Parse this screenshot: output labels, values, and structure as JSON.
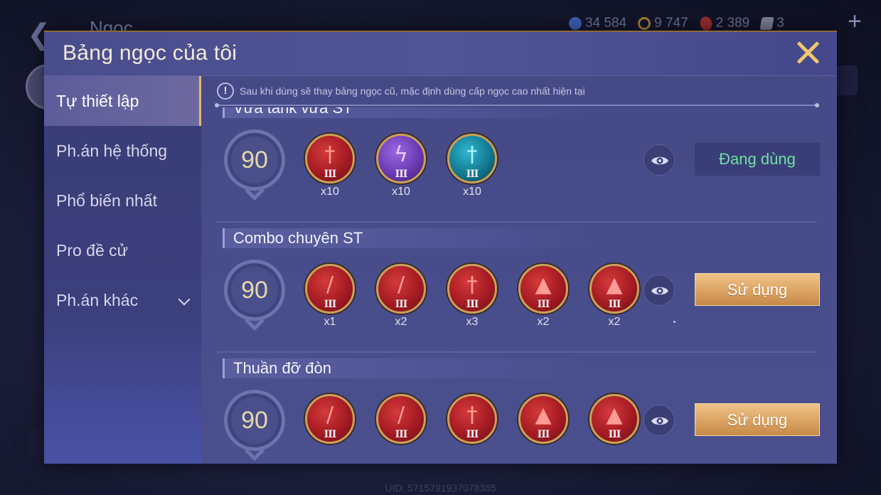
{
  "background": {
    "title": "Ngọc",
    "currencies": [
      {
        "icon": "blue-gem-icon",
        "value": "34 584"
      },
      {
        "icon": "gold-coin-icon",
        "value": "9 747"
      },
      {
        "icon": "red-crystal-icon",
        "value": "2 389"
      },
      {
        "icon": "card-icon",
        "value": "3"
      }
    ],
    "uid": "UID: 5715791937078385"
  },
  "modal": {
    "title": "Bảng ngọc của tôi",
    "sidebar": [
      {
        "label": "Tự thiết lập",
        "active": true
      },
      {
        "label": "Ph.án hệ thống",
        "active": false
      },
      {
        "label": "Phổ biến nhất",
        "active": false
      },
      {
        "label": "Pro đề cử",
        "active": false
      },
      {
        "label": "Ph.án khác",
        "active": false,
        "has_dropdown": true
      }
    ],
    "notice": "Sau khi dùng sẽ thay bảng ngọc cũ, mặc định dùng cấp ngọc cao nhất hiện tại",
    "sets": [
      {
        "name": "Vừa tank vừa ST",
        "level": "90",
        "gems": [
          {
            "color": "red",
            "glyph": "sword",
            "tier": "III",
            "count": "x10"
          },
          {
            "color": "purple",
            "glyph": "lightning",
            "tier": "III",
            "count": "x10"
          },
          {
            "color": "teal",
            "glyph": "sword",
            "tier": "III",
            "count": "x10"
          }
        ],
        "action": "Đang dùng",
        "action_state": "in-use"
      },
      {
        "name": "Combo chuyên ST",
        "level": "90",
        "gems": [
          {
            "color": "red",
            "glyph": "blade",
            "tier": "III",
            "count": "x1"
          },
          {
            "color": "red",
            "glyph": "blade",
            "tier": "III",
            "count": "x2"
          },
          {
            "color": "red",
            "glyph": "sword",
            "tier": "III",
            "count": "x3"
          },
          {
            "color": "red",
            "glyph": "spike",
            "tier": "III",
            "count": "x2"
          },
          {
            "color": "red",
            "glyph": "spike",
            "tier": "III",
            "count": "x2"
          }
        ],
        "action": "Sử dụng",
        "action_state": "use"
      },
      {
        "name": "Thuần đỡ đòn",
        "level": "90",
        "gems": [
          {
            "color": "red",
            "glyph": "blade",
            "tier": "III",
            "count": ""
          },
          {
            "color": "red",
            "glyph": "blade",
            "tier": "III",
            "count": ""
          },
          {
            "color": "red",
            "glyph": "sword",
            "tier": "III",
            "count": ""
          },
          {
            "color": "red",
            "glyph": "spike",
            "tier": "III",
            "count": ""
          },
          {
            "color": "red",
            "glyph": "spike",
            "tier": "III",
            "count": ""
          }
        ],
        "action": "Sử dụng",
        "action_state": "use"
      }
    ]
  },
  "colors": {
    "accent_gold": "#f2c66b",
    "in_use_green": "#6fe0a3",
    "modal_bg": "#3f437b"
  }
}
